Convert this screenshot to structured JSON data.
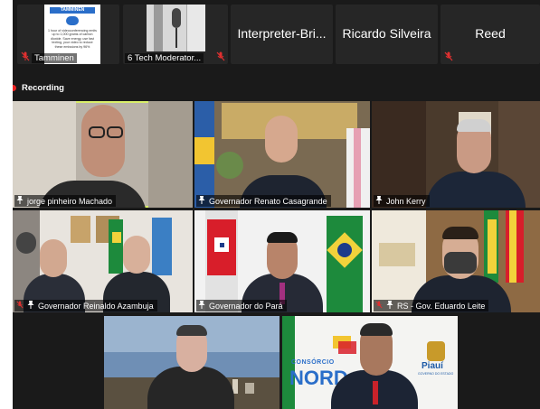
{
  "top_strip": [
    {
      "id": "tamminen",
      "label": "Tamminen",
      "type": "thumbnail",
      "muted": true,
      "thumb_title": "TAMMINEN",
      "thumb_text": "1 hour of videoconferencing emits up to 1,000 grams of carbon dioxide. Save energy, use fast texting, your video to reduce these emissions by 96%"
    },
    {
      "id": "tech-moderator",
      "label": "6 Tech Moderator...",
      "type": "thumbnail",
      "muted": true
    },
    {
      "id": "interpreter",
      "label": "Interpreter-Bri...",
      "type": "name",
      "muted": false
    },
    {
      "id": "ricardo",
      "label": "Ricardo Silveira",
      "type": "name",
      "muted": false
    },
    {
      "id": "reed",
      "label": "Reed",
      "type": "name",
      "muted": true
    }
  ],
  "recording_label": "Recording",
  "participants": [
    {
      "name": "jorge pinheiro Machado",
      "pinned": true,
      "muted": false,
      "active": true
    },
    {
      "name": "Governador Renato Casagrande",
      "pinned": true,
      "muted": false
    },
    {
      "name": "John Kerry",
      "pinned": true,
      "muted": false
    },
    {
      "name": "Governador Reinaldo Azambuja",
      "pinned": true,
      "muted": true
    },
    {
      "name": "Governador do Pará",
      "pinned": true,
      "muted": false
    },
    {
      "name": "RS - Gov. Eduardo Leite",
      "pinned": true,
      "muted": true
    },
    {
      "name": "",
      "pinned": false,
      "muted": false
    },
    {
      "name": "",
      "pinned": false,
      "muted": false
    }
  ],
  "backdrop_text": {
    "consorcio": "CONSÓRCIO",
    "nord": "NORD",
    "piaui": "Piauí",
    "governo": "GOVERNO DO ESTADO"
  },
  "colors": {
    "background": "#1a1a1a",
    "tile": "#262626",
    "active_border": "#d9ef6a",
    "muted_icon": "#e03030",
    "recording_dot": "#ee2222"
  }
}
